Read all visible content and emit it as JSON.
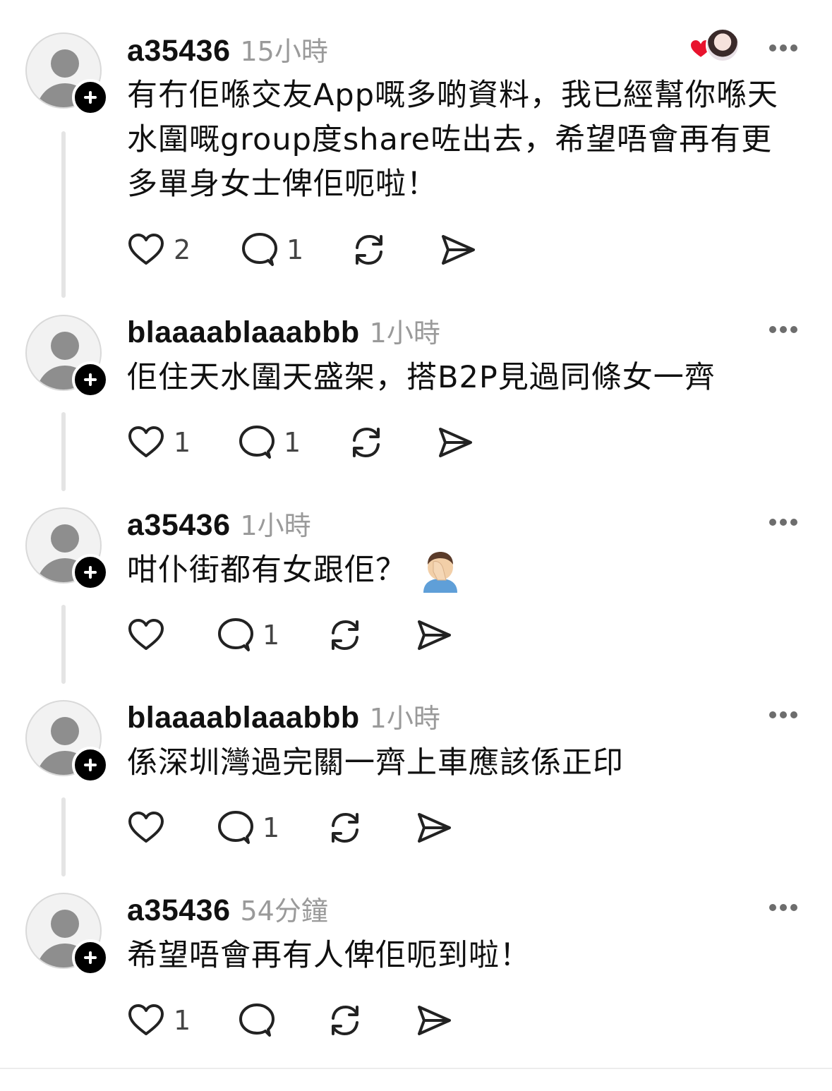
{
  "posts": [
    {
      "username": "a35436",
      "time": "15小時",
      "lines": [
        "有冇佢喺交友App嘅多啲資料，我已經幫你喺天",
        "水圍嘅group度share咗出去，希望唔會再有更",
        "多單身女士俾佢呃啦！"
      ],
      "likes": "2",
      "replies": "1"
    },
    {
      "username": "blaaaablaaabbb",
      "time": "1小時",
      "lines": [
        "佢住天水圍天盛架，搭B2P見過同條女一齊"
      ],
      "likes": "1",
      "replies": "1"
    },
    {
      "username": "a35436",
      "time": "1小時",
      "lines": [
        "咁仆街都有女跟佢？"
      ],
      "emoji": "man-facepalming",
      "likes": "",
      "replies": "1"
    },
    {
      "username": "blaaaablaaabbb",
      "time": "1小時",
      "lines": [
        "係深圳灣過完關一齊上車應該係正印"
      ],
      "likes": "",
      "replies": "1"
    },
    {
      "username": "a35436",
      "time": "54分鐘",
      "lines": [
        "希望唔會再有人俾佢呃到啦！"
      ],
      "likes": "1",
      "replies": ""
    }
  ],
  "icons": {
    "like": "heart-icon",
    "reply": "comment-icon",
    "repost": "repost-icon",
    "share": "send-icon",
    "more": "more-dots-icon",
    "follow": "plus-icon"
  },
  "colors": {
    "heart": "#e8132d",
    "secondary_text": "#9a9a9a"
  }
}
